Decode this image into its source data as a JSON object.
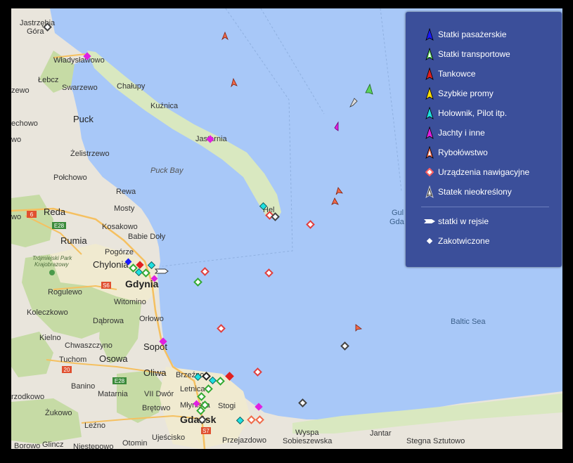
{
  "map": {
    "places": {
      "jastrzebia": "Jastrzębia",
      "gora": "Góra",
      "wladyslawowo": "Władysławowo",
      "lebcz": "Łebcz",
      "swarzewo": "Swarzewo",
      "zewo": "zewo",
      "chalupy": "Chałupy",
      "kuznica": "Kuźnica",
      "echowo": "echowo",
      "puck": "Puck",
      "wo": "wo",
      "jastarnia": "Jastarnia",
      "zelistrzewo": "Żelistrzewo",
      "polchowo": "Połchowo",
      "puck_bay": "Puck Bay",
      "rewa": "Rewa",
      "wo2": "wo",
      "reda": "Reda",
      "mosty": "Mosty",
      "hel": "Hel",
      "kosakowo": "Kosakowo",
      "babie_doly": "Babie Doły",
      "rumia": "Rumia",
      "pogorze": "Pogórze",
      "trojmiejski": "Trójmiejski Park",
      "krajobrazowy": "Krajobrazowy",
      "chylonia": "Chylonia",
      "gdynia": "Gdynia",
      "rogulewo": "Rogulewo",
      "witomino": "Witomino",
      "koleczkowo": "Koleczkowo",
      "dabrowa": "Dąbrowa",
      "orlowo": "Orłowo",
      "kielno": "Kielno",
      "chwaszczyno": "Chwaszczyno",
      "sopot": "Sopot",
      "tuchom": "Tuchom",
      "osowa": "Osowa",
      "oliwa": "Oliwa",
      "brzezno": "Brzeźno",
      "banino": "Banino",
      "matarnia": "Matarnia",
      "vii_dwor": "VII Dwór",
      "letnica": "Letnica",
      "rzodkowo": "rzodkowo",
      "zukowo": "Żukowo",
      "bretowo": "Brętowo",
      "mlyniska": "Młyniska",
      "stogi": "Stogi",
      "gdansk": "Gdańsk",
      "lezno": "Leźno",
      "wyspa": "Wyspa",
      "sobieszewska": "Sobieszewska",
      "jantar": "Jantar",
      "borowo": "Borowo",
      "glincz": "Glincz",
      "niestepowo": "Niestępowo",
      "otomin": "Otomin",
      "ujescisko": "Ujeścisko",
      "przejazdowo": "Przejazdowo",
      "stegna": "Stegna",
      "sztutowo": "Sztutowo",
      "gul": "Gul",
      "gda": "Gda",
      "baltic_sea": "Baltic Sea"
    },
    "roads": {
      "r6": "6",
      "e28a": "E28",
      "s6": "S6",
      "r20": "20",
      "e28b": "E28",
      "s7": "S7"
    },
    "colors": {
      "sea": "#a8c8f8",
      "land": "#e9e5dc",
      "forest": "#c6dba5",
      "urban": "#f0ead0"
    }
  },
  "legend": {
    "items": [
      {
        "label": "Statki pasażerskie",
        "icon": "passenger-ship-icon",
        "color": "#1a1aff"
      },
      {
        "label": "Statki transportowe",
        "icon": "cargo-ship-icon",
        "color": "#5bd35b"
      },
      {
        "label": "Tankowce",
        "icon": "tanker-icon",
        "color": "#e02020"
      },
      {
        "label": "Szybkie promy",
        "icon": "fast-ferry-icon",
        "color": "#ffdd00"
      },
      {
        "label": "Holownik, Pilot itp.",
        "icon": "tug-pilot-icon",
        "color": "#1ee0e0"
      },
      {
        "label": "Jachty i inne",
        "icon": "yacht-icon",
        "color": "#e020e0"
      },
      {
        "label": "Rybołówstwo",
        "icon": "fishing-icon",
        "color": "#f06a4a"
      },
      {
        "label": "Urządzenia nawigacyjne",
        "icon": "navaid-icon",
        "color": "#ff8080"
      },
      {
        "label": "Statek nieokreślony",
        "icon": "unknown-ship-icon",
        "color": "#555555"
      }
    ],
    "status": [
      {
        "label": "statki w rejsie",
        "icon": "underway-icon"
      },
      {
        "label": "Zakotwiczone",
        "icon": "anchored-icon"
      }
    ]
  }
}
